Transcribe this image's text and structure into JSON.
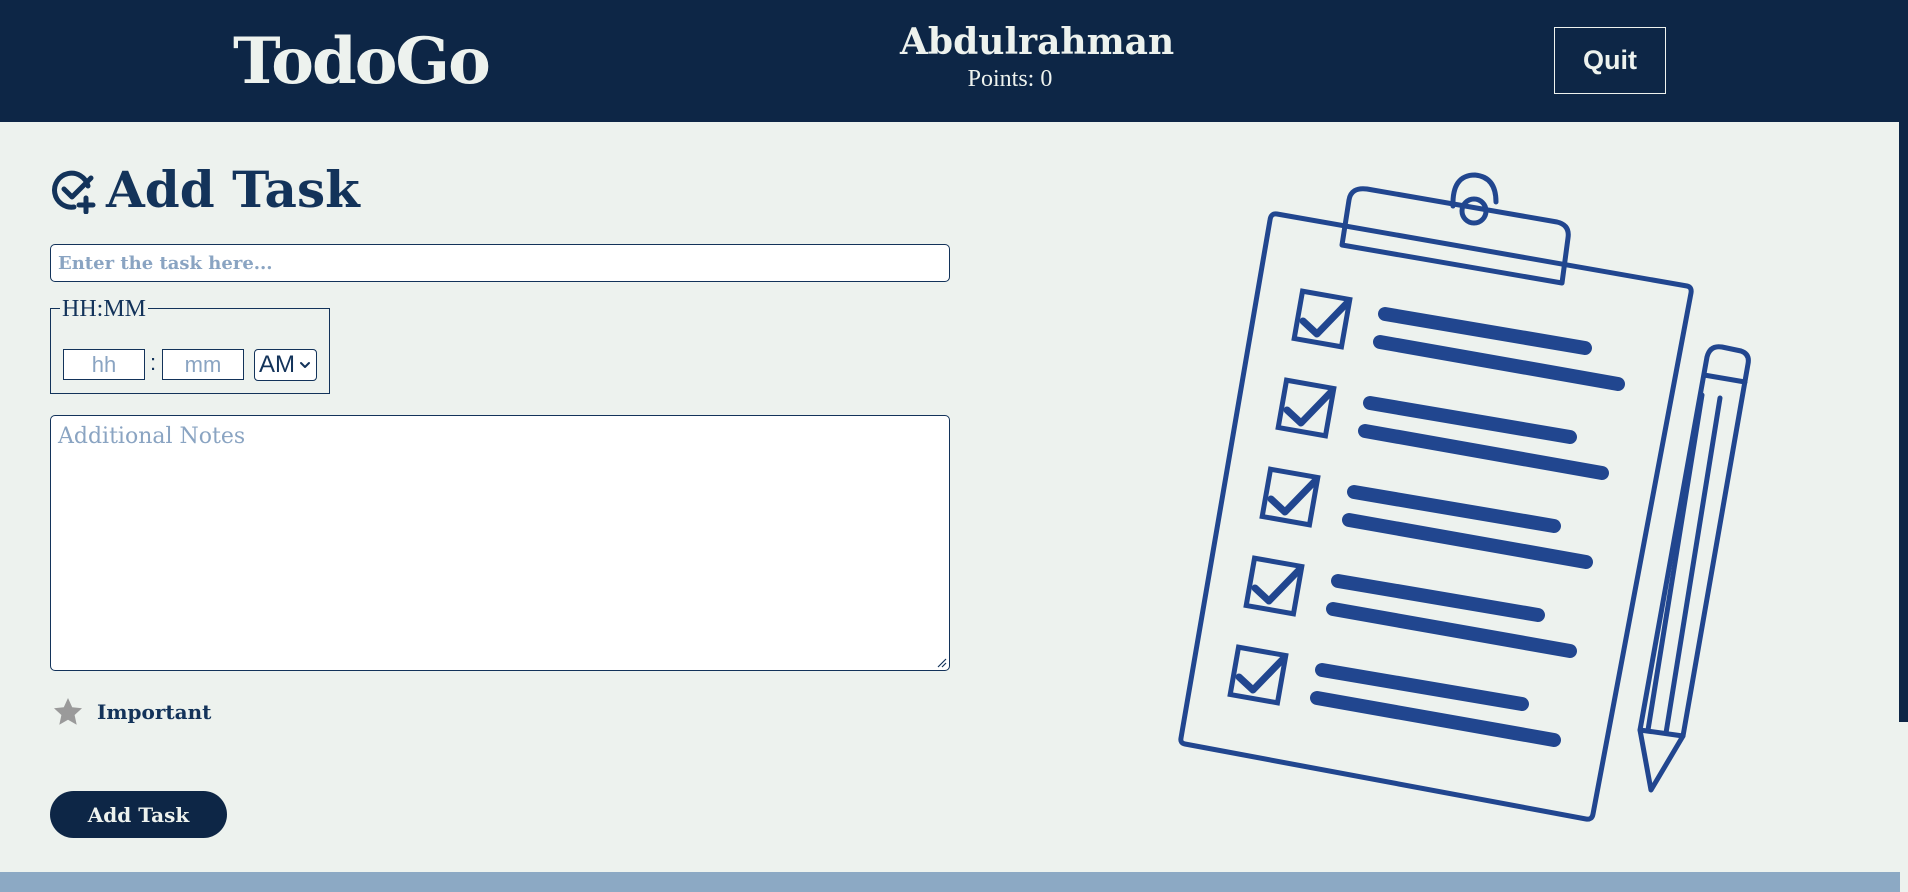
{
  "header": {
    "logo": "TodoGo",
    "username": "Abdulrahman",
    "points": "Points: 0",
    "quit_label": "Quit"
  },
  "form": {
    "title": "Add Task",
    "task_placeholder": "Enter the task here...",
    "time_legend": "HH:MM",
    "hh_placeholder": "hh",
    "mm_placeholder": "mm",
    "time_separator": ":",
    "ampm_value": "AM",
    "notes_placeholder": "Additional Notes",
    "important_label": "Important",
    "submit_label": "Add Task"
  },
  "colors": {
    "navy": "#0d2646",
    "accent_blue": "#21468f",
    "background": "#edf2ee",
    "placeholder": "#8aa4c2",
    "footer": "#8ca9c4",
    "star": "#9a9a9a"
  },
  "icons": {
    "title_icon": "check-circle-plus-icon",
    "important_icon": "star-icon",
    "ampm_icon": "chevron-down-icon",
    "illustration": "clipboard-checklist-pencil"
  }
}
